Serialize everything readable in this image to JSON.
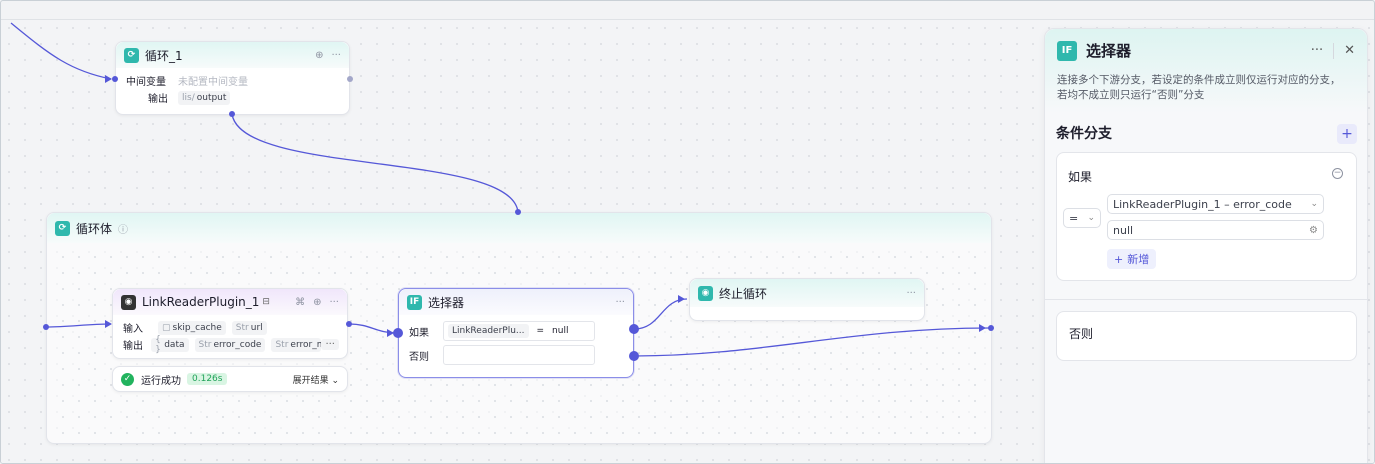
{
  "loop_node": {
    "title": "循环_1",
    "row1_label": "中间变量",
    "row1_value": "未配置中间变量",
    "row2_label": "输出",
    "row2_tag_prefix": "lis/",
    "row2_tag": "output"
  },
  "loop_body": {
    "title": "循环体",
    "info_icon": "ⓘ"
  },
  "plugin_node": {
    "title": "LinkReaderPlugin_1",
    "input_label": "输入",
    "input_tags": [
      {
        "prefix": "▢",
        "name": "skip_cache"
      },
      {
        "prefix": "Str",
        "name": "url"
      }
    ],
    "output_label": "输出",
    "output_tags": [
      {
        "prefix": "{ }",
        "name": "data"
      },
      {
        "prefix": "Str",
        "name": "error_code"
      },
      {
        "prefix": "Str",
        "name": "error_msg"
      }
    ],
    "status_text": "运行成功",
    "status_time": "0.126s",
    "expand_label": "展开结果"
  },
  "selector_node": {
    "icon_text": "IF",
    "title": "选择器",
    "if_label": "如果",
    "cond_var": "LinkReaderPlu...",
    "cond_op": "=",
    "cond_val": "null",
    "else_label": "否则"
  },
  "end_loop_node": {
    "title": "终止循环"
  },
  "panel": {
    "icon_text": "IF",
    "title": "选择器",
    "more": "···",
    "close": "✕",
    "description_line1": "连接多个下游分支，若设定的条件成立则仅运行对应的分支，",
    "description_line2": "若均不成立则只运行“否则”分支",
    "section_title": "条件分支",
    "add_symbol": "+",
    "if_card": {
      "label": "如果",
      "operator": "=",
      "variable": "LinkReaderPlugin_1 – error_code",
      "value": "null",
      "add_label": "新增"
    },
    "else_card": {
      "label": "否则"
    }
  },
  "colors": {
    "accent": "#5558d8",
    "teal": "#2fb8ad",
    "success": "#22b35e"
  }
}
